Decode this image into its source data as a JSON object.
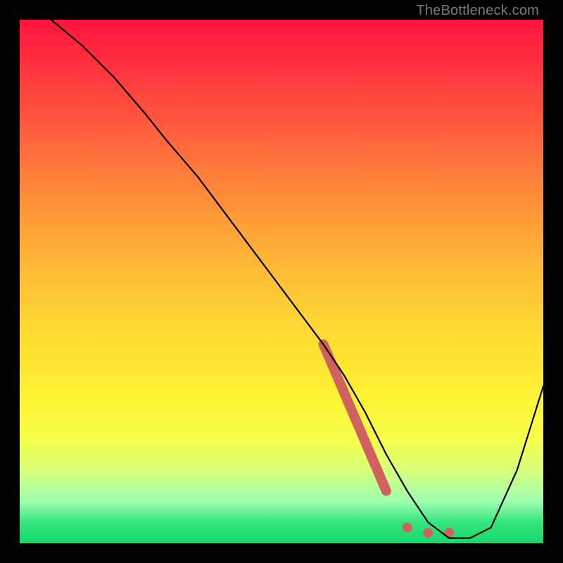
{
  "attribution": "TheBottleneck.com",
  "chart_data": {
    "type": "line",
    "title": "",
    "xlabel": "",
    "ylabel": "",
    "xlim": [
      0,
      100
    ],
    "ylim": [
      0,
      100
    ],
    "background_gradient": {
      "top_color": "#ff143d",
      "bottom_color": "#17d96a",
      "stops": [
        {
          "pct": 0,
          "color": "#ff143d"
        },
        {
          "pct": 50,
          "color": "#ffc335"
        },
        {
          "pct": 80,
          "color": "#f7ff4a"
        },
        {
          "pct": 100,
          "color": "#17d96a"
        }
      ]
    },
    "series": [
      {
        "name": "bottleneck-curve",
        "color": "#000000",
        "x": [
          0,
          6,
          12,
          18,
          24,
          28,
          34,
          40,
          46,
          52,
          58,
          62,
          66,
          70,
          74,
          78,
          82,
          86,
          90,
          95,
          100
        ],
        "y": [
          105,
          100,
          95,
          89,
          82,
          77,
          70,
          62,
          54,
          46,
          38,
          32,
          25,
          17,
          10,
          4,
          1,
          1,
          3,
          14,
          30
        ]
      }
    ],
    "highlight_segment": {
      "color": "#d16060",
      "width": 14,
      "x": [
        58,
        70
      ],
      "y": [
        38,
        10
      ]
    },
    "highlight_dots": {
      "color": "#d16060",
      "radius": 7,
      "points": [
        {
          "x": 74,
          "y": 3
        },
        {
          "x": 78,
          "y": 2
        },
        {
          "x": 82,
          "y": 2
        }
      ]
    }
  }
}
